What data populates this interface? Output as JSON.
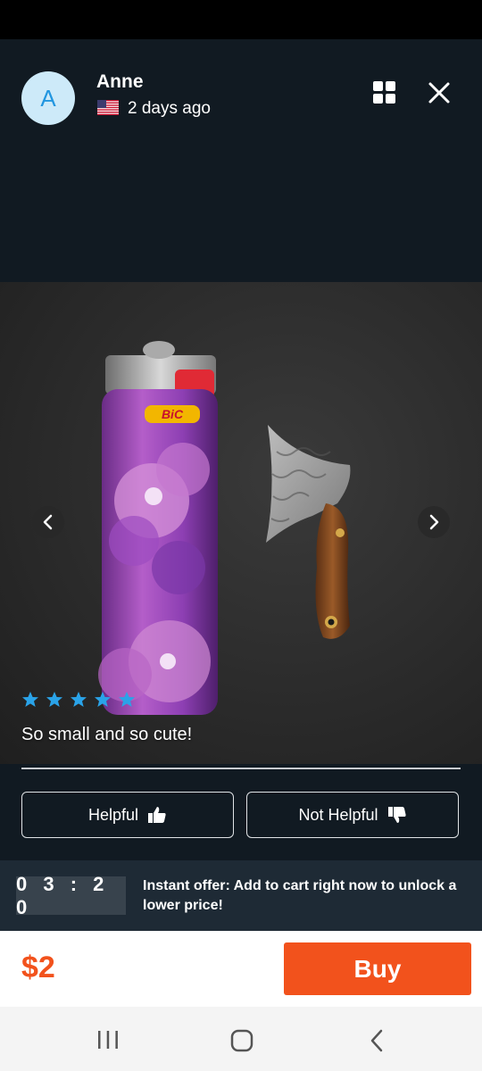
{
  "review": {
    "avatar_letter": "A",
    "user_name": "Anne",
    "country_flag_icon": "us-flag-icon",
    "posted": "2 days ago",
    "rating": 5,
    "text": "So small and so cute!"
  },
  "photo": {
    "lighter_brand": "BiC"
  },
  "actions": {
    "helpful_label": "Helpful",
    "not_helpful_label": "Not Helpful"
  },
  "offer": {
    "timer": "03:20",
    "message": "Instant offer: Add to cart right now to unlock a lower price!"
  },
  "purchase": {
    "price": "$2",
    "buy_label": "Buy"
  },
  "colors": {
    "accent": "#f2521c",
    "star": "#2aa3e8",
    "background": "#111a22"
  }
}
